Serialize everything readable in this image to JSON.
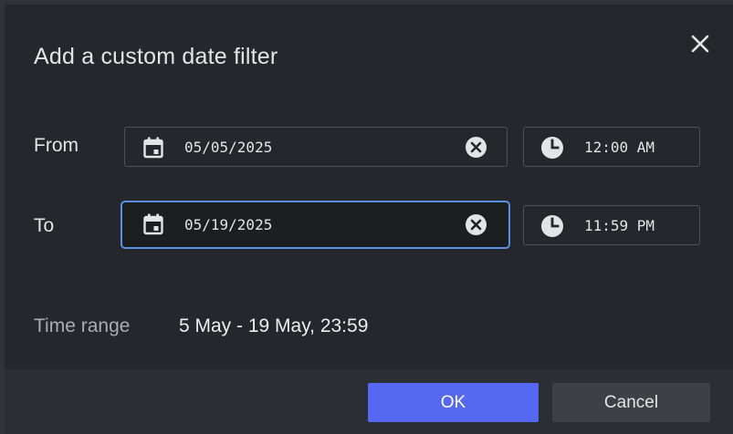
{
  "dialog": {
    "title": "Add a custom date filter",
    "close_icon": "close-icon"
  },
  "from": {
    "label": "From",
    "date": "05/05/2025",
    "time": "12:00 AM",
    "calendar_icon": "calendar-icon",
    "clear_icon": "clear-circle-icon",
    "clock_icon": "clock-icon"
  },
  "to": {
    "label": "To",
    "date": "05/19/2025",
    "time": "11:59 PM",
    "focused": true,
    "calendar_icon": "calendar-icon",
    "clear_icon": "clear-circle-icon",
    "clock_icon": "clock-icon"
  },
  "time_range": {
    "label": "Time range",
    "value": "5 May - 19 May, 23:59"
  },
  "buttons": {
    "ok": "OK",
    "cancel": "Cancel"
  },
  "colors": {
    "background": "#24272b",
    "footer": "#2b2e32",
    "accent": "#5468f2",
    "focus_border": "#5b8fe0",
    "secondary_button": "#3d4045"
  }
}
